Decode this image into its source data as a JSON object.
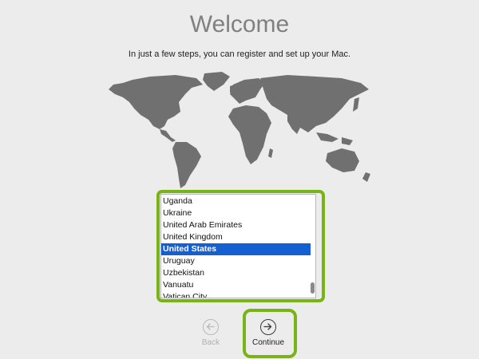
{
  "header": {
    "title": "Welcome",
    "subtitle": "In just a few steps, you can register and set up your Mac."
  },
  "country_list": {
    "items": [
      "Uganda",
      "Ukraine",
      "United Arab Emirates",
      "United Kingdom",
      "United States",
      "Uruguay",
      "Uzbekistan",
      "Vanuatu",
      "Vatican City"
    ],
    "selected": "United States"
  },
  "navigation": {
    "back_label": "Back",
    "back_enabled": false,
    "continue_label": "Continue",
    "back_icon": "arrow-left-circle-icon",
    "continue_icon": "arrow-right-circle-icon"
  },
  "colors": {
    "background": "#ececec",
    "selection": "#1460d2",
    "highlight_outline": "#78b414",
    "map_land": "#707070"
  }
}
